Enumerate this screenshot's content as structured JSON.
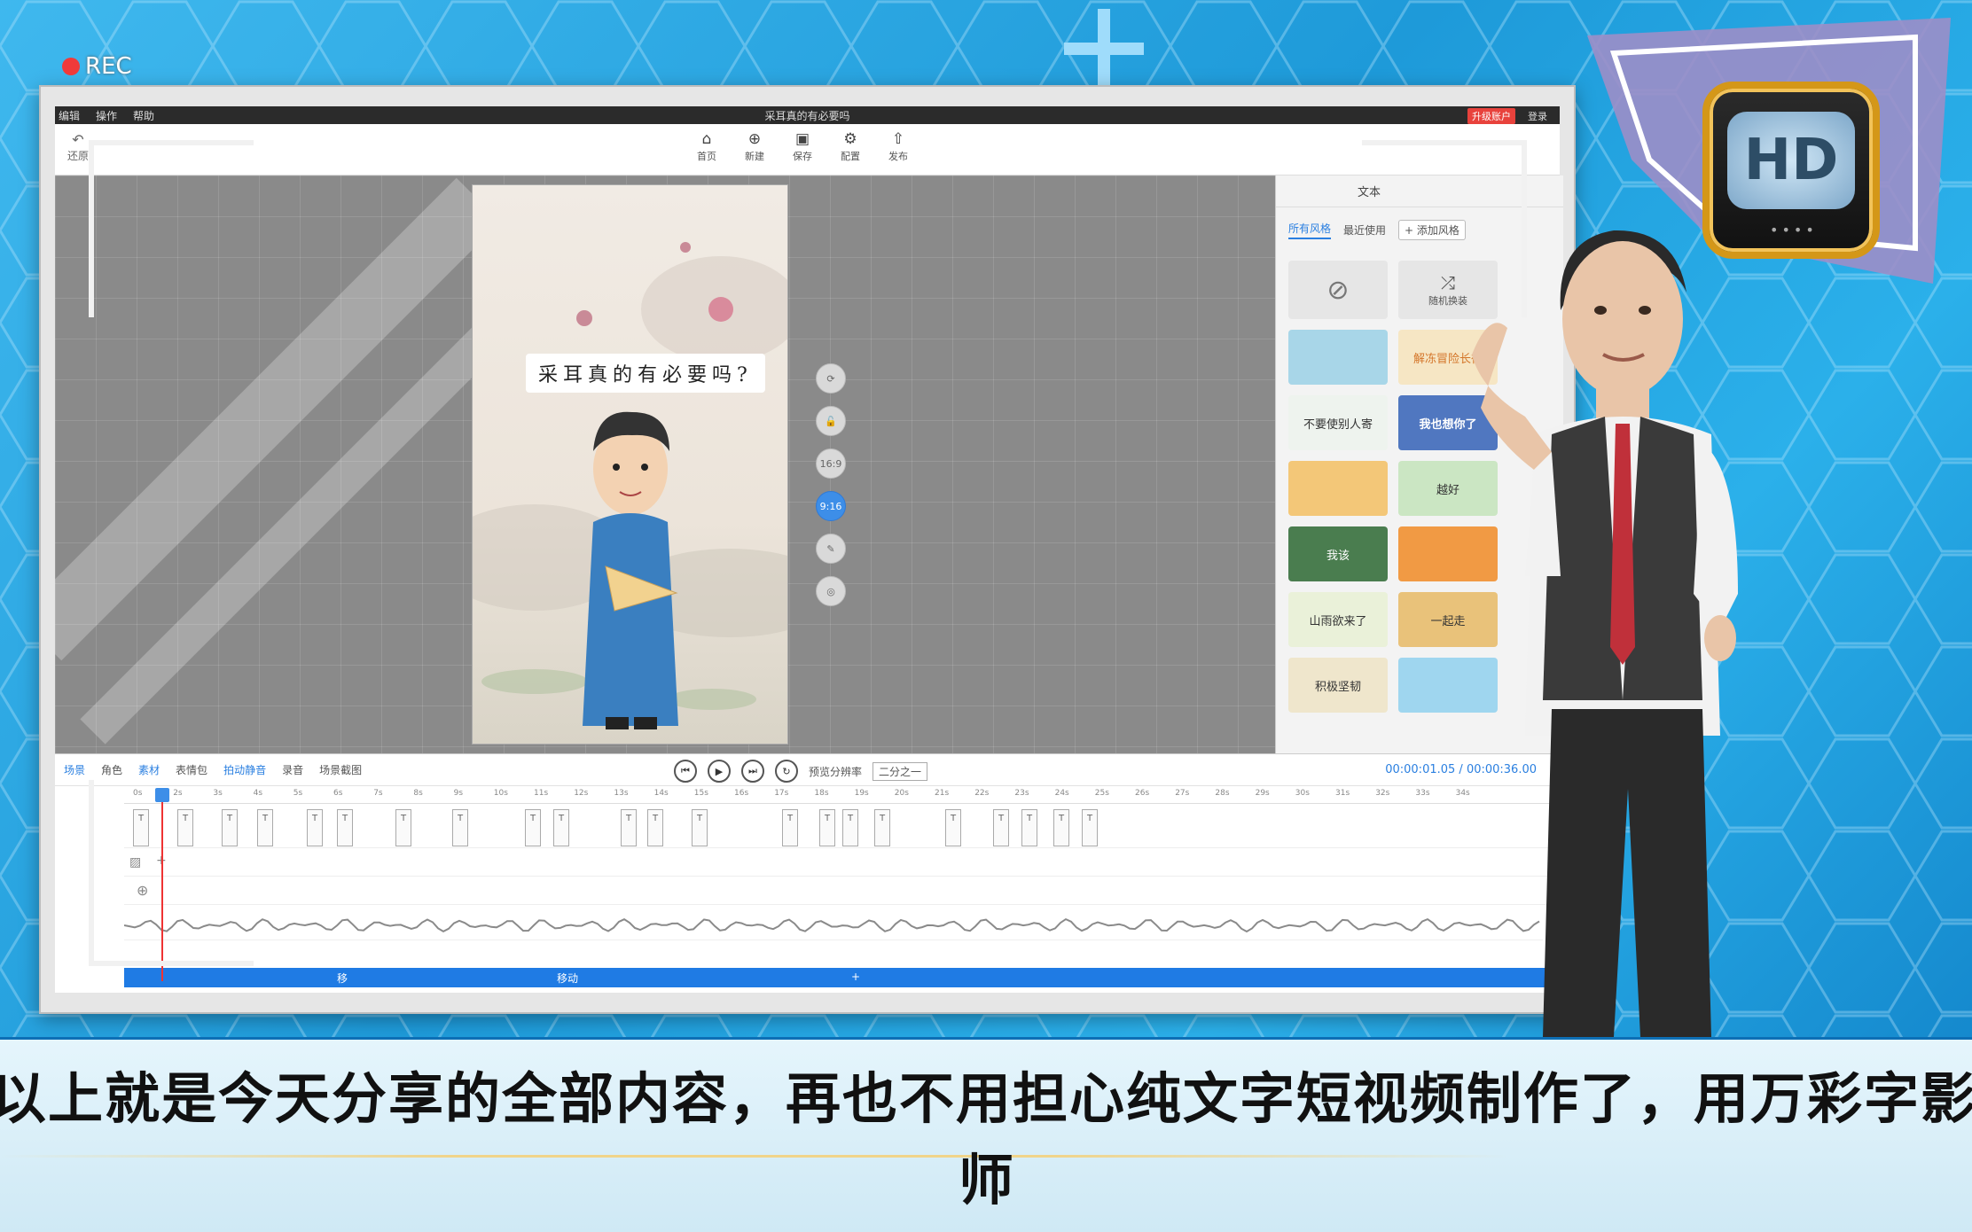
{
  "window": {
    "menu": [
      "编辑",
      "操作",
      "帮助"
    ],
    "title": "采耳真的有必要吗",
    "upgrade": "升级账户",
    "login": "登录"
  },
  "rec": "REC",
  "toolbar": {
    "undo": "还原",
    "buttons": [
      {
        "icon": "home-icon",
        "glyph": "⌂",
        "label": "首页"
      },
      {
        "icon": "new-icon",
        "glyph": "⊕",
        "label": "新建"
      },
      {
        "icon": "save-icon",
        "glyph": "▣",
        "label": "保存"
      },
      {
        "icon": "settings-icon",
        "glyph": "⚙",
        "label": "配置"
      },
      {
        "icon": "publish-icon",
        "glyph": "⇧",
        "label": "发布"
      }
    ]
  },
  "canvas": {
    "phone_title": "采耳真的有必要吗?"
  },
  "side_tools": [
    "⟳",
    "🔓",
    "16:9",
    "9:16",
    "✎",
    "◎"
  ],
  "right_panel": {
    "tab": "文本",
    "subtabs": [
      "所有风格",
      "最近使用"
    ],
    "add": "+ 添加风格",
    "random": "随机换装",
    "tiles": [
      {
        "text": "",
        "bg": "#a8d6e8"
      },
      {
        "text": "解冻冒险长征",
        "bg": "#f6e6c4"
      },
      {
        "text": "不要使别人寄",
        "bg": "#eef3ee"
      },
      {
        "text": "我也想你了",
        "bg": "#5077c0"
      },
      {
        "text": "",
        "bg": "#f3c778"
      },
      {
        "text": "越好",
        "bg": "#cbe6c3"
      },
      {
        "text": "我该",
        "bg": "#4a7d4f"
      },
      {
        "text": "",
        "bg": "#f19a44"
      },
      {
        "text": "山雨欲来了",
        "bg": "#eaf1d9"
      },
      {
        "text": "一起走",
        "bg": "#e9c27a"
      },
      {
        "text": "积极坚韧",
        "bg": "#efe6cc"
      },
      {
        "text": "",
        "bg": "#9fd6ef"
      },
      {
        "text": "",
        "bg": "#f5e6d2"
      },
      {
        "text": "",
        "bg": "#cfeafa"
      }
    ]
  },
  "timeline": {
    "tabs": [
      "场景",
      "角色",
      "素材",
      "表情包",
      "拍动静音",
      "录音",
      "场景截图"
    ],
    "speed_label": "预览分辨率",
    "speed_value": "二分之一",
    "time_current": "00:00:01.05",
    "time_total": "00:00:36.00",
    "ruler": [
      "0s",
      "2s",
      "3s",
      "4s",
      "5s",
      "6s",
      "7s",
      "8s",
      "9s",
      "10s",
      "11s",
      "12s",
      "13s",
      "14s",
      "15s",
      "16s",
      "17s",
      "18s",
      "19s",
      "20s",
      "21s",
      "22s",
      "23s",
      "24s",
      "25s",
      "26s",
      "27s",
      "28s",
      "29s",
      "30s",
      "31s",
      "32s",
      "33s",
      "34s"
    ],
    "blue_track_labels": [
      "移",
      "移动",
      "+"
    ]
  },
  "logo": {
    "text": "HD",
    "dots": "••••"
  },
  "subtitle": {
    "line1": "以上就是今天分享的全部内容，再也不用担心纯文字短视频制作了，用万彩字影",
    "line2": "师"
  }
}
